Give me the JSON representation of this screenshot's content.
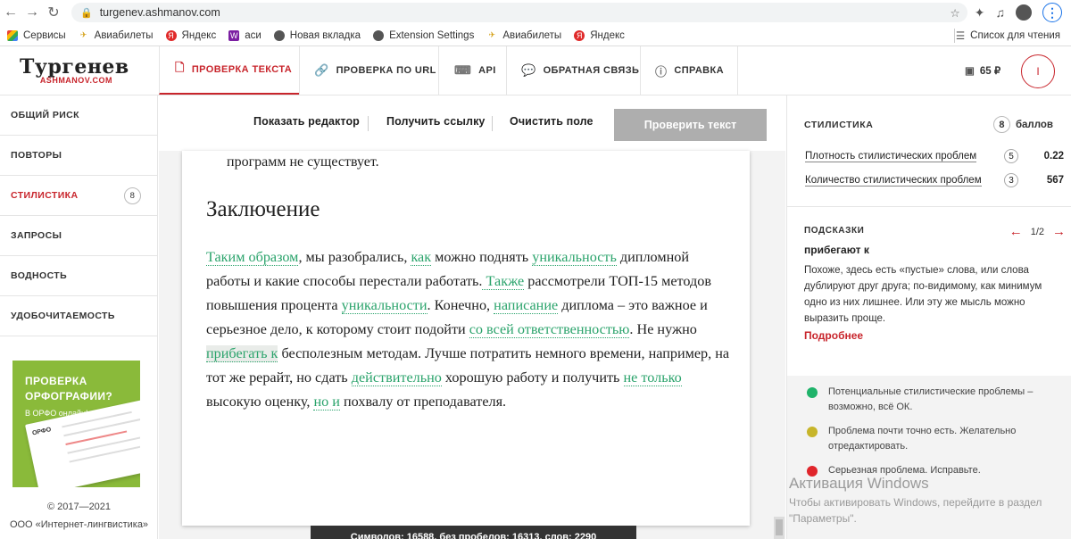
{
  "browser": {
    "url": "turgenev.ashmanov.com",
    "bookmarks": [
      "Сервисы",
      "Авиабилеты",
      "Яндекс",
      "аси",
      "Новая вкладка",
      "Extension Settings",
      "Авиабилеты",
      "Яндекс"
    ],
    "reading_list": "Список для чтения"
  },
  "logo": {
    "main": "Тургенев",
    "sub": "ASHMANOV.COM"
  },
  "tabs": [
    "ПРОВЕРКА ТЕКСТА",
    "ПРОВЕРКА ПО URL",
    "API",
    "ОБРАТНАЯ СВЯЗЬ",
    "СПРАВКА"
  ],
  "balance": "65 ₽",
  "user_initial": "I",
  "sidebar": {
    "items": [
      {
        "label": "ОБЩИЙ РИСК"
      },
      {
        "label": "ПОВТОРЫ"
      },
      {
        "label": "СТИЛИСТИКА",
        "badge": "8"
      },
      {
        "label": "ЗАПРОСЫ"
      },
      {
        "label": "ВОДНОСТЬ"
      },
      {
        "label": "УДОБОЧИТАЕМОСТЬ"
      }
    ],
    "promo": {
      "title1": "ПРОВЕРКА",
      "title2": "ОРФОГРАФИИ?",
      "subtitle": "В ОРФО онлайн!",
      "card_label": "ОРФО"
    },
    "copyright": "© 2017—2021",
    "company": "ООО «Интернет-лингвистика»"
  },
  "toolbar": {
    "show_editor": "Показать редактор",
    "get_link": "Получить ссылку",
    "clear": "Очистить поле",
    "check": "Проверить текст"
  },
  "document": {
    "prev_tail": "программ не существует.",
    "heading": "Заключение",
    "p": [
      {
        "hl": "Таким образом"
      },
      {
        "t": ", мы разобрались, "
      },
      {
        "hl": "как"
      },
      {
        "t": " можно поднять "
      },
      {
        "hl": "уникальность"
      },
      {
        "t": " дипломной работы и какие способы перестали работать."
      },
      {
        "hl": " Также"
      },
      {
        "t": " рассмотрели ТОП-15 методов повышения процента "
      },
      {
        "hl": "уникальности"
      },
      {
        "t": ". Конечно, "
      },
      {
        "hl": "написание"
      },
      {
        "t": " диплома – это важное и серьезное дело, к которому стоит подойти "
      },
      {
        "hl": "со всей ответственностью"
      },
      {
        "t": ". Не нужно "
      },
      {
        "hlg": "прибегать к"
      },
      {
        "t": " бесполезным методам. Лучше потратить немного времени, например, на тот же рерайт, но сдать "
      },
      {
        "hl": "действительно"
      },
      {
        "t": " хорошую работу и получить "
      },
      {
        "hl": "не только"
      },
      {
        "t": " высокую оценку, "
      },
      {
        "hl": "но и"
      },
      {
        "t": " похвалу от преподавателя."
      }
    ],
    "stats": "Символов: 16588, без пробелов: 16313, слов: 2290"
  },
  "right_panel": {
    "title": "СТИЛИСТИКА",
    "score": "8",
    "score_unit": "баллов",
    "metrics": [
      {
        "label": "Плотность стилистических проблем",
        "badge": "5",
        "value": "0.22"
      },
      {
        "label": "Количество стилистических проблем",
        "badge": "3",
        "value": "567"
      }
    ],
    "hints": {
      "title": "ПОДСКАЗКИ",
      "pager": "1/2",
      "word": "прибегают к",
      "text": "Похоже, здесь есть «пустые» слова, или слова дублируют друг друга; по-видимому, как минимум одно из них лишнее. Или эту же мысль можно выразить проще.",
      "more": "Подробнее"
    },
    "legend": [
      {
        "color": "#1fb36a",
        "text": "Потенциальные стилистические проблемы – возможно, всё ОК."
      },
      {
        "color": "#c7b52a",
        "text": "Проблема почти точно есть. Желательно отредактировать."
      },
      {
        "color": "#e0252b",
        "text": "Серьезная проблема. Исправьте."
      }
    ]
  },
  "windows_activation": {
    "title": "Активация Windows",
    "text": "Чтобы активировать Windows, перейдите в раздел \"Параметры\"."
  }
}
